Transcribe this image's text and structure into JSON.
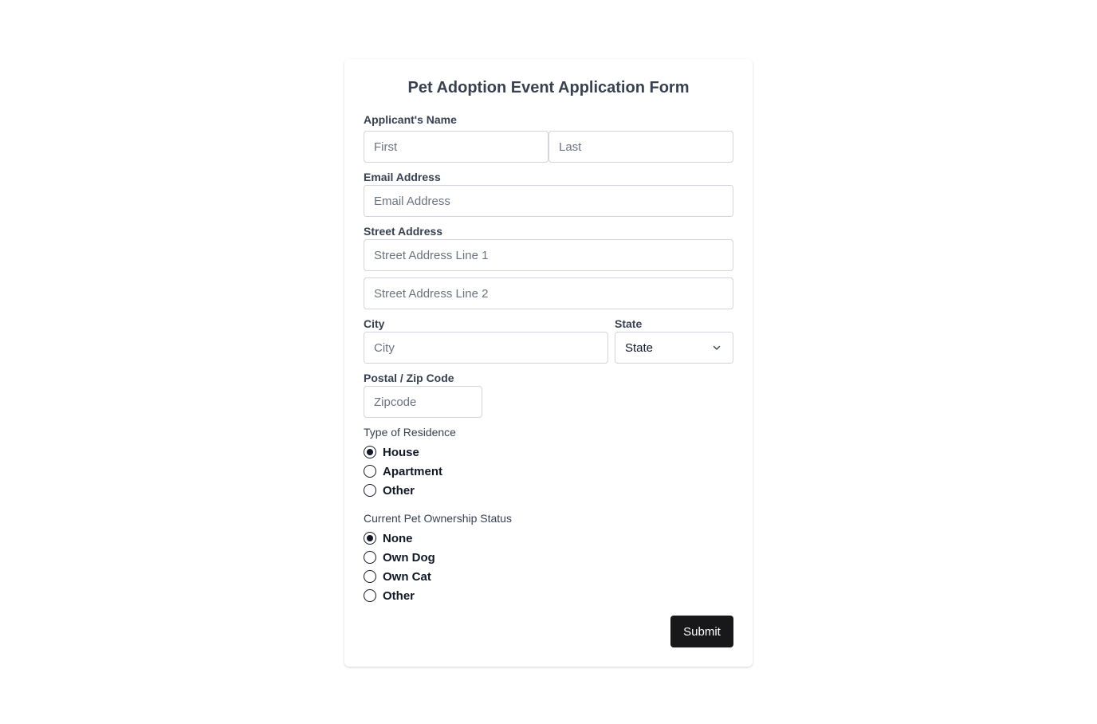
{
  "form": {
    "title": "Pet Adoption Event Application Form",
    "name": {
      "label": "Applicant's Name",
      "first_placeholder": "First",
      "last_placeholder": "Last"
    },
    "email": {
      "label": "Email Address",
      "placeholder": "Email Address"
    },
    "street": {
      "label": "Street Address",
      "line1_placeholder": "Street Address Line 1",
      "line2_placeholder": "Street Address Line 2"
    },
    "city": {
      "label": "City",
      "placeholder": "City"
    },
    "state": {
      "label": "State",
      "selected": "State"
    },
    "zip": {
      "label": "Postal / Zip Code",
      "placeholder": "Zipcode"
    },
    "residence": {
      "label": "Type of Residence",
      "options": [
        {
          "label": "House",
          "checked": true
        },
        {
          "label": "Apartment",
          "checked": false
        },
        {
          "label": "Other",
          "checked": false
        }
      ]
    },
    "ownership": {
      "label": "Current Pet Ownership Status",
      "options": [
        {
          "label": "None",
          "checked": true
        },
        {
          "label": "Own Dog",
          "checked": false
        },
        {
          "label": "Own Cat",
          "checked": false
        },
        {
          "label": "Other",
          "checked": false
        }
      ]
    },
    "submit_label": "Submit"
  },
  "colors": {
    "button_bg": "#18181b",
    "text": "#374151",
    "border": "#d1d5db"
  }
}
